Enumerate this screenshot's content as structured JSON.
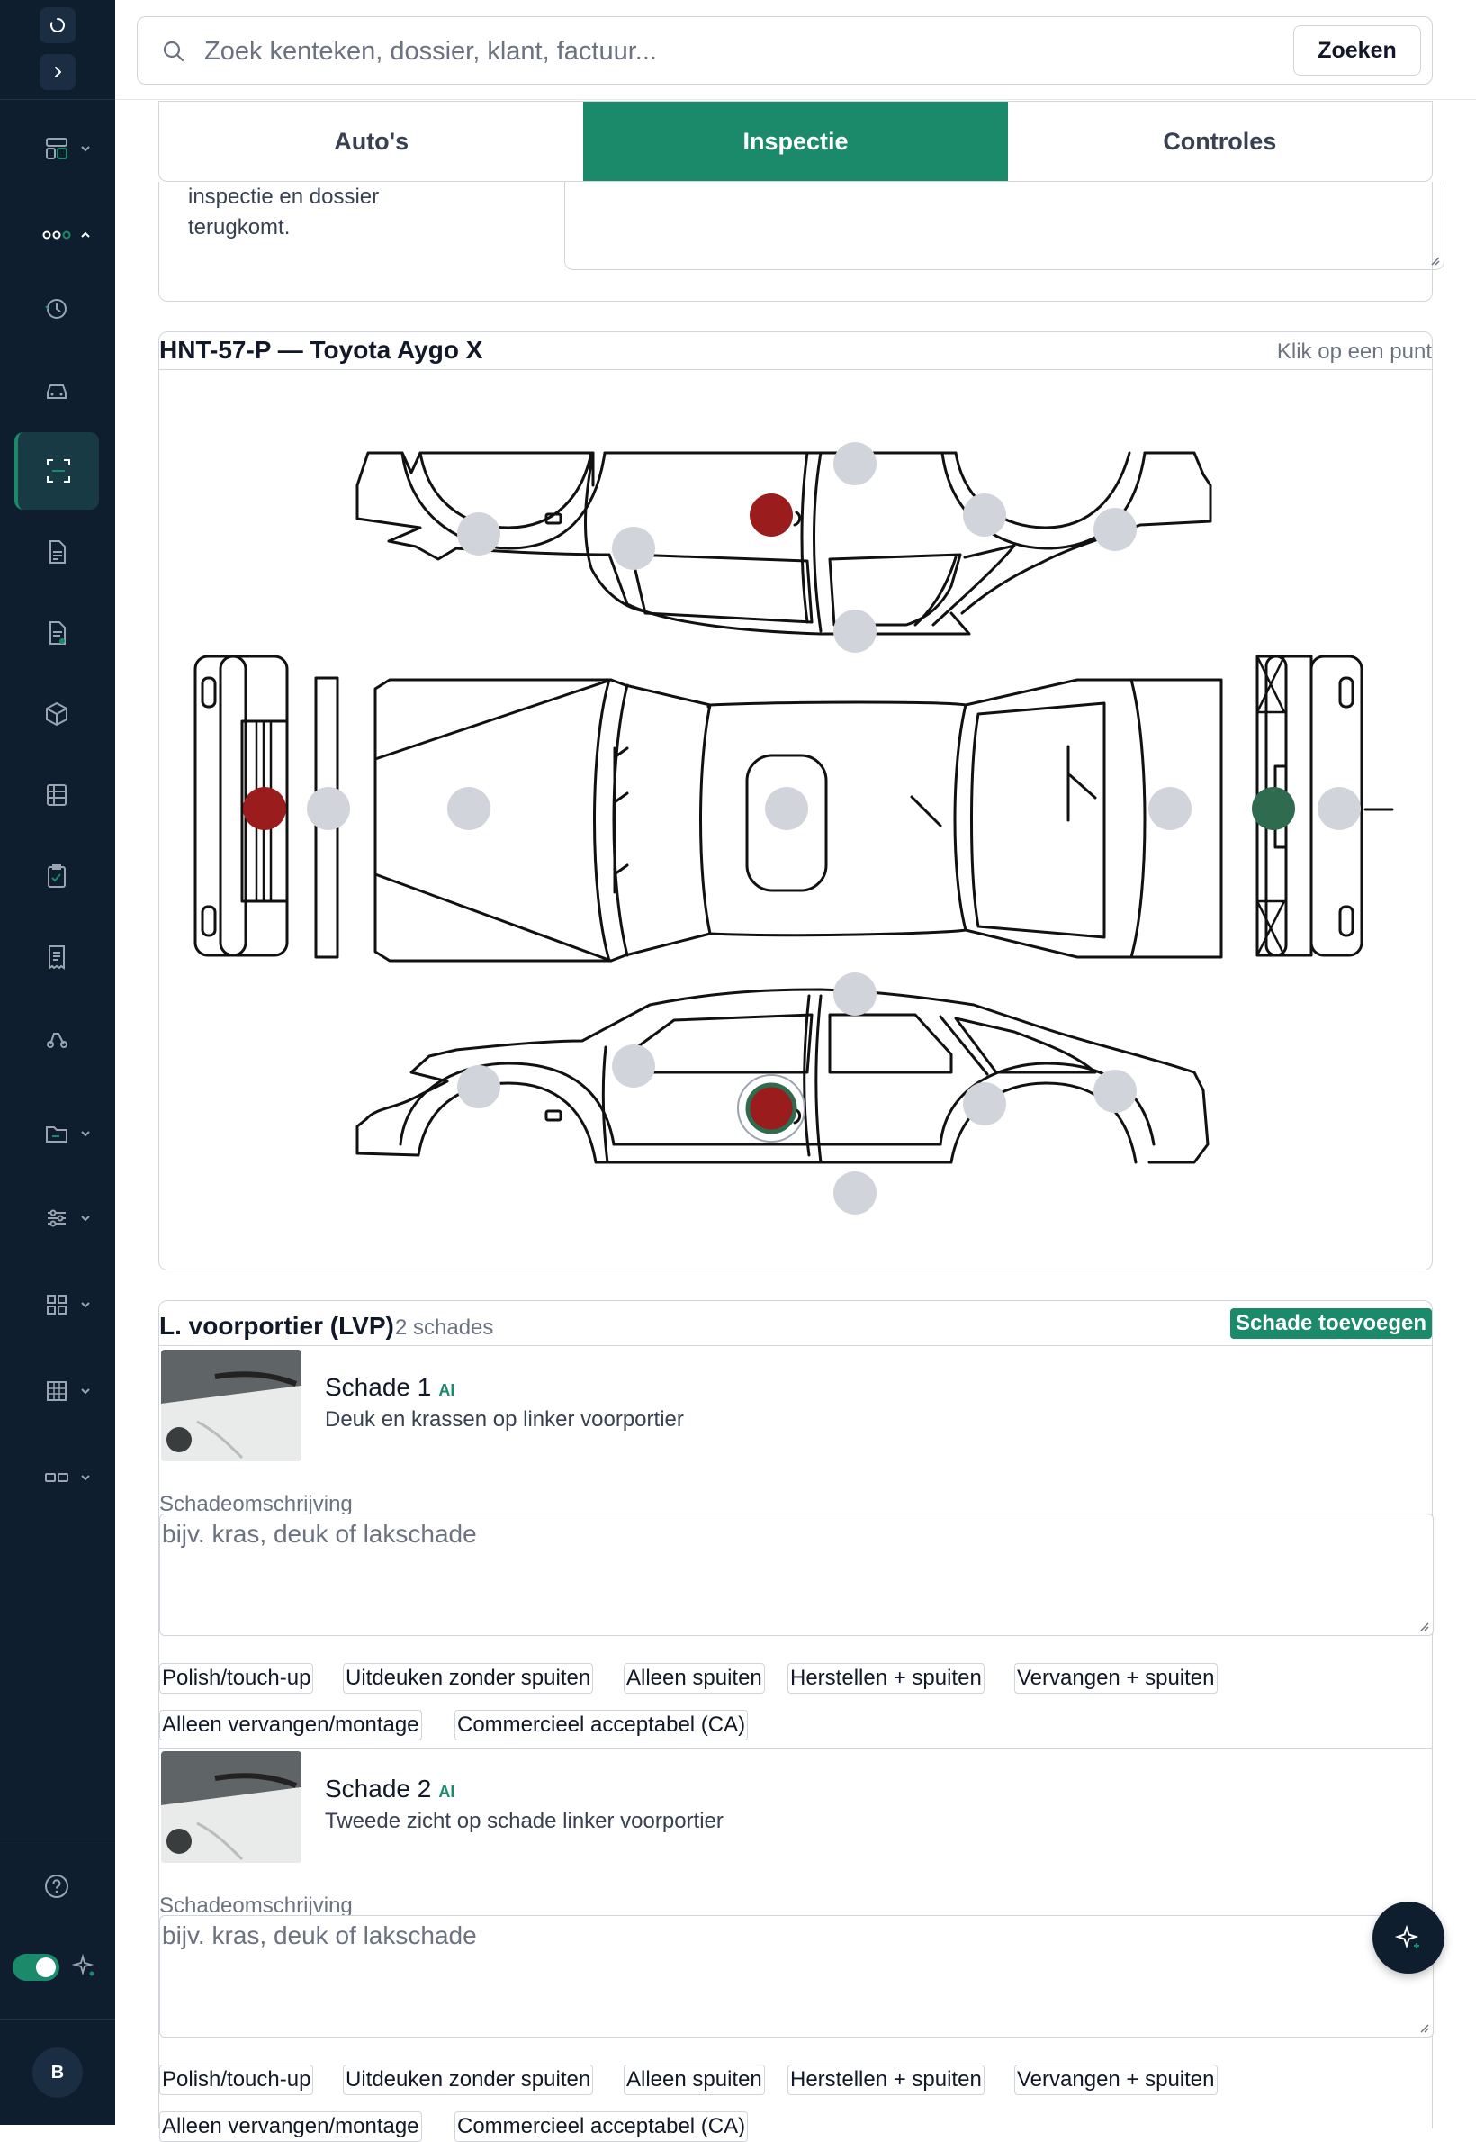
{
  "search": {
    "placeholder": "Zoek kenteken, dossier, klant, factuur...",
    "button_label": "Zoeken"
  },
  "tabs": [
    {
      "label": "Auto's",
      "active": false
    },
    {
      "label": "Inspectie",
      "active": true
    },
    {
      "label": "Controles",
      "active": false
    }
  ],
  "inspection_note": "inspectie en dossier terugkomt.",
  "diagram": {
    "plate_title": "HNT-57-P — Toyota Aygo X",
    "hint": "Klik op een punt",
    "point_states": {
      "damaged": "#9b1c1c",
      "selected_ok": "#2f6b4f",
      "empty": "#d1d5db"
    }
  },
  "damage_panel": {
    "part_name": "L. voorportier (LVP)",
    "count_label": "2 schades",
    "add_button": "Schade toevoegen",
    "entries": [
      {
        "title": "Schade 1",
        "ai_badge": "AI",
        "description": "Deuk en krassen op linker voorportier",
        "field_label": "Schadeomschrijving",
        "placeholder": "bijv. kras, deuk of lakschade"
      },
      {
        "title": "Schade 2",
        "ai_badge": "AI",
        "description": "Tweede zicht op schade linker voorportier",
        "field_label": "Schadeomschrijving",
        "placeholder": "bijv. kras, deuk of lakschade"
      }
    ],
    "repair_options": [
      "Polish/touch-up",
      "Uitdeuken zonder spuiten",
      "Alleen spuiten",
      "Herstellen + spuiten",
      "Vervangen + spuiten",
      "Alleen vervangen/montage",
      "Commercieel acceptabel (CA)"
    ]
  },
  "user": {
    "avatar_initial": "B"
  },
  "colors": {
    "accent": "#1a8a6a",
    "sidebar": "#0f1e2e"
  }
}
